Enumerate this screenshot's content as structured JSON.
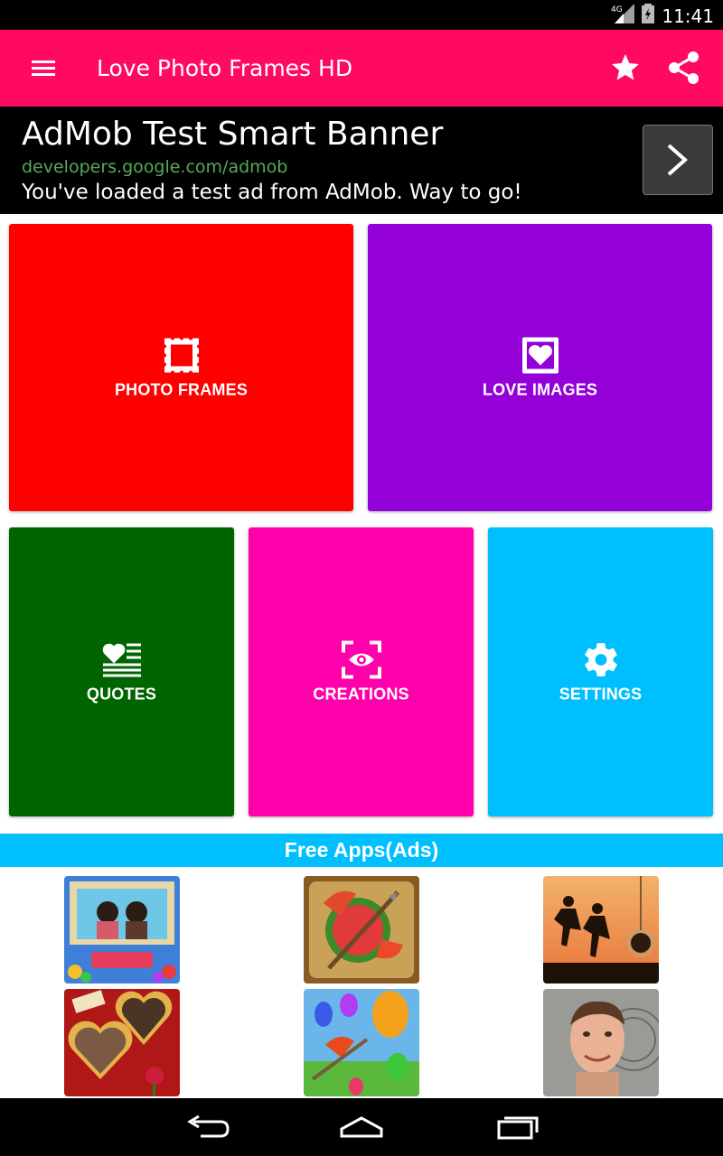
{
  "status_bar": {
    "network": "4G",
    "time": "11:41"
  },
  "app_bar": {
    "title": "Love Photo Frames HD",
    "icons": [
      "menu-icon",
      "star-icon",
      "share-icon"
    ],
    "color": "#ff0a60"
  },
  "ad": {
    "title": "AdMob Test Smart Banner",
    "url": "developers.google.com/admob",
    "description": "You've loaded a test ad from AdMob. Way to go!",
    "url_color": "#57a85b"
  },
  "tiles": [
    {
      "label": "PHOTO FRAMES",
      "icon": "frame-icon",
      "color": "#ff0000"
    },
    {
      "label": "LOVE IMAGES",
      "icon": "heart-picture-icon",
      "color": "#9400d8"
    },
    {
      "label": "QUOTES",
      "icon": "heart-list-icon",
      "color": "#006400"
    },
    {
      "label": "CREATIONS",
      "icon": "eye-scan-icon",
      "color": "#ff00aa"
    },
    {
      "label": "SETTINGS",
      "icon": "gear-icon",
      "color": "#00bfff"
    }
  ],
  "free_apps": {
    "title": "Free Apps(Ads)",
    "color": "#00bfff",
    "apps": [
      {
        "icon": "birthday-frames-thumbnail"
      },
      {
        "icon": "fruit-slice-game-thumbnail"
      },
      {
        "icon": "silhouette-photo-thumbnail"
      },
      {
        "icon": "heart-frames-thumbnail"
      },
      {
        "icon": "balloon-game-thumbnail"
      },
      {
        "icon": "face-photo-thumbnail"
      }
    ]
  },
  "nav_bar": {
    "icons": [
      "back-icon",
      "home-icon",
      "recents-icon"
    ]
  }
}
